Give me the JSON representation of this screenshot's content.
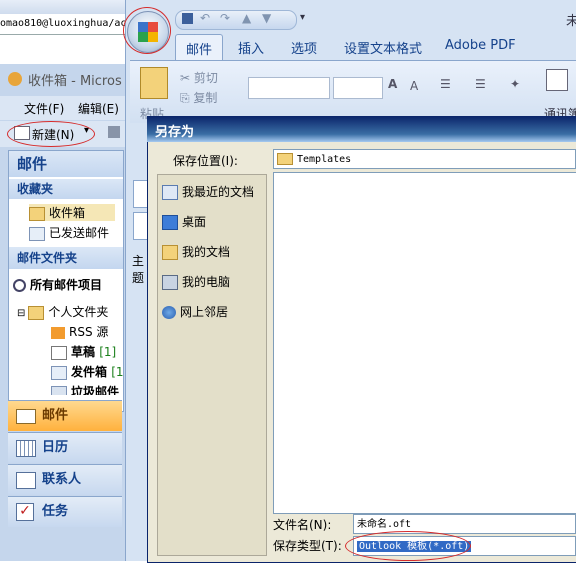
{
  "browser": {
    "url_fragment": "omao810@luoxinghua/ac"
  },
  "outlook": {
    "title": "收件箱 - Micros",
    "menu": {
      "file": "文件(F)",
      "edit": "编辑(E)"
    },
    "toolbar": {
      "new_label": "新建(N)",
      "new_arrow": "▾"
    },
    "nav_header": "邮件",
    "favorites_header": "收藏夹",
    "favorites": [
      {
        "label": "收件箱"
      },
      {
        "label": "已发送邮件"
      }
    ],
    "mail_folders_header": "邮件文件夹",
    "all_mail": "所有邮件项目",
    "folders": [
      {
        "label": "个人文件夹",
        "count": ""
      },
      {
        "label": "RSS 源",
        "count": ""
      },
      {
        "label": "草稿",
        "count": "[1]"
      },
      {
        "label": "发件箱",
        "count": "[1"
      },
      {
        "label": "垃圾邮件",
        "count": ""
      }
    ],
    "nav_buttons": [
      {
        "label": "邮件"
      },
      {
        "label": "日历"
      },
      {
        "label": "联系人"
      },
      {
        "label": "任务"
      }
    ]
  },
  "compose": {
    "title_fragment": "未",
    "tabs": [
      "邮件",
      "插入",
      "选项",
      "设置文本格式",
      "Adobe PDF"
    ],
    "active_tab": "邮件",
    "ribbon": {
      "paste": "粘贴",
      "cut": "剪切",
      "copy": "复制",
      "address": "通讯簿"
    },
    "subject_label": "主题"
  },
  "dialog": {
    "title": "另存为",
    "save_in_label": "保存位置(I):",
    "save_in_value": "Templates",
    "places": [
      {
        "label": "我最近的文档",
        "icon": "recent-docs-icon"
      },
      {
        "label": "桌面",
        "icon": "desktop-icon"
      },
      {
        "label": "我的文档",
        "icon": "my-documents-icon"
      },
      {
        "label": "我的电脑",
        "icon": "my-computer-icon"
      },
      {
        "label": "网上邻居",
        "icon": "network-icon"
      }
    ],
    "filename_label": "文件名(N):",
    "filename_value": "未命名.oft",
    "filetype_label": "保存类型(T):",
    "filetype_value": "Outlook 模板(*.oft)"
  },
  "colors": {
    "highlight_ellipse": "#d52b2b",
    "selection": "#316ac5",
    "title_bar": "#0a246a"
  }
}
